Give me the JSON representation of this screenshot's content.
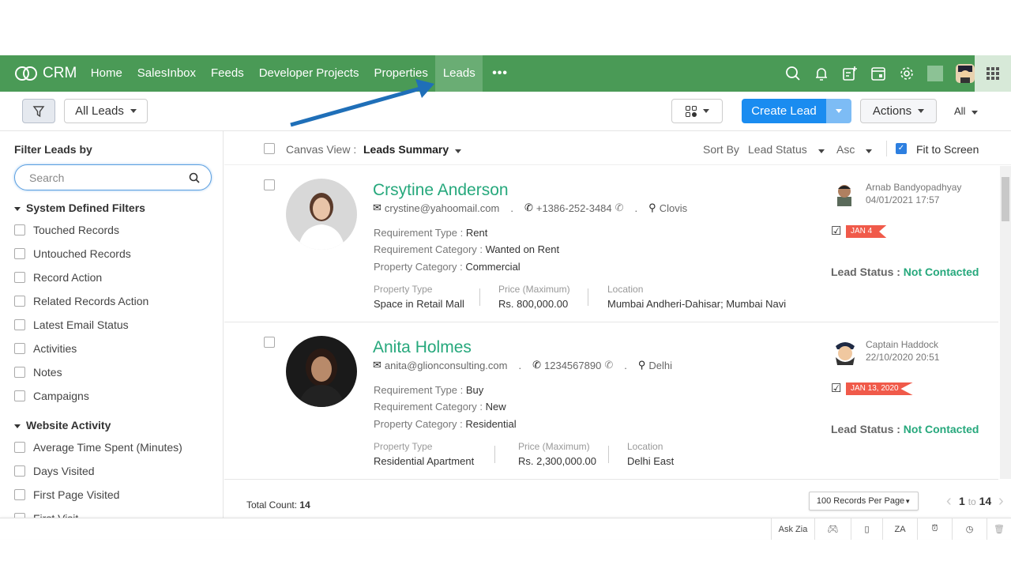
{
  "nav": {
    "logo": "CRM",
    "tabs": [
      "Home",
      "SalesInbox",
      "Feeds",
      "Developer Projects",
      "Properties",
      "Leads"
    ],
    "active_tab": "Leads",
    "more": "•••",
    "icons": [
      "search-icon",
      "bell-icon",
      "add-note-icon",
      "calendar-icon",
      "gear-icon",
      "avatar",
      "apps-grid-icon"
    ],
    "color": "#4a9a56"
  },
  "toolbar": {
    "view_select": "All Leads",
    "create_label": "Create Lead",
    "actions_label": "Actions",
    "all_label": "All"
  },
  "sidebar": {
    "title": "Filter Leads by",
    "search_placeholder": "Search",
    "sections": [
      {
        "title": "System Defined Filters",
        "items": [
          "Touched Records",
          "Untouched Records",
          "Record Action",
          "Related Records Action",
          "Latest Email Status",
          "Activities",
          "Notes",
          "Campaigns"
        ]
      },
      {
        "title": "Website Activity",
        "items": [
          "Average Time Spent (Minutes)",
          "Days Visited",
          "First Page Visited",
          "First Visit"
        ]
      }
    ]
  },
  "main": {
    "canvas_label": "Canvas View :",
    "canvas_value": "Leads Summary",
    "sort_label": "Sort By",
    "sort_field": "Lead Status",
    "sort_order": "Asc",
    "fit_label": "Fit to Screen",
    "fit_checked": true
  },
  "leads": [
    {
      "name": "Crsytine Anderson",
      "email": "crystine@yahoomail.com",
      "phone": "+1386-252-3484",
      "city": "Clovis",
      "req_type_label": "Requirement Type :",
      "req_type": "Rent",
      "req_cat_label": "Requirement Category :",
      "req_cat": "Wanted on Rent",
      "prop_cat_label": "Property Category :",
      "prop_cat": "Commercial",
      "prop_type_label": "Property Type",
      "prop_type": "Space in Retail Mall",
      "price_label": "Price (Maximum)",
      "price": "Rs. 800,000.00",
      "location_label": "Location",
      "location": "Mumbai Andheri-Dahisar; Mumbai Navi",
      "owner": "Arnab Bandyopadhyay",
      "modified": "04/01/2021 17:57",
      "task_date": "JAN 4",
      "status_label": "Lead Status :",
      "status": "Not Contacted"
    },
    {
      "name": "Anita Holmes",
      "email": "anita@glionconsulting.com",
      "phone": "1234567890",
      "city": "Delhi",
      "req_type_label": "Requirement Type :",
      "req_type": "Buy",
      "req_cat_label": "Requirement Category :",
      "req_cat": "New",
      "prop_cat_label": "Property Category :",
      "prop_cat": "Residential",
      "prop_type_label": "Property Type",
      "prop_type": "Residential Apartment",
      "price_label": "Price (Maximum)",
      "price": "Rs. 2,300,000.00",
      "location_label": "Location",
      "location": "Delhi East",
      "owner": "Captain Haddock",
      "modified": "22/10/2020 20:51",
      "task_date": "JAN 13, 2020",
      "status_label": "Lead Status :",
      "status": "Not Contacted"
    }
  ],
  "footer": {
    "total_label": "Total Count:",
    "total": "14",
    "per_page": "100 Records Per Page",
    "page_from": "1",
    "page_to_word": "to",
    "page_to": "14"
  },
  "bottombar": {
    "ask_zia": "Ask Zia",
    "icons": [
      "gamepad-icon",
      "notes-icon",
      "zia-icon",
      "alarm-icon",
      "history-icon",
      "trash-icon"
    ]
  }
}
